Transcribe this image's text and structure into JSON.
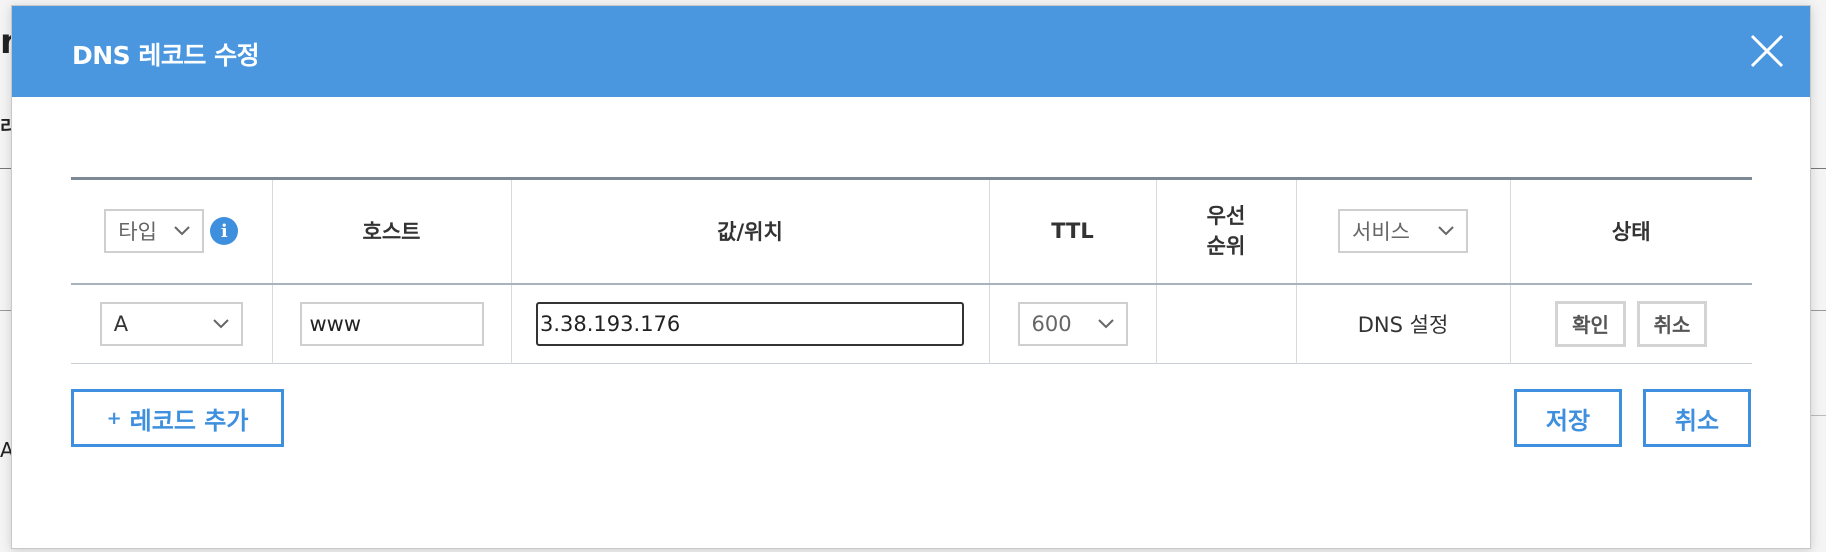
{
  "background": {
    "fragment_top": "n",
    "fragment_mid": "리",
    "fragment_low": "A"
  },
  "modal": {
    "title": "DNS 레코드 수정",
    "close_icon": "close-icon"
  },
  "table": {
    "headers": {
      "type_select": "타입",
      "host": "호스트",
      "value": "값/위치",
      "ttl": "TTL",
      "priority": "우선\n순위",
      "service_select": "서비스",
      "status": "상태"
    },
    "row": {
      "type": "A",
      "host": "www",
      "value": "3.38.193.176",
      "ttl": "600",
      "priority": "",
      "service": "DNS 설정",
      "confirm_label": "확인",
      "cancel_label": "취소"
    }
  },
  "actions": {
    "add_record_label": "레코드 추가",
    "add_record_prefix": "+",
    "save_label": "저장",
    "cancel_label": "취소"
  },
  "colors": {
    "header_bg": "#4a97e0",
    "accent": "#3e8fde"
  }
}
